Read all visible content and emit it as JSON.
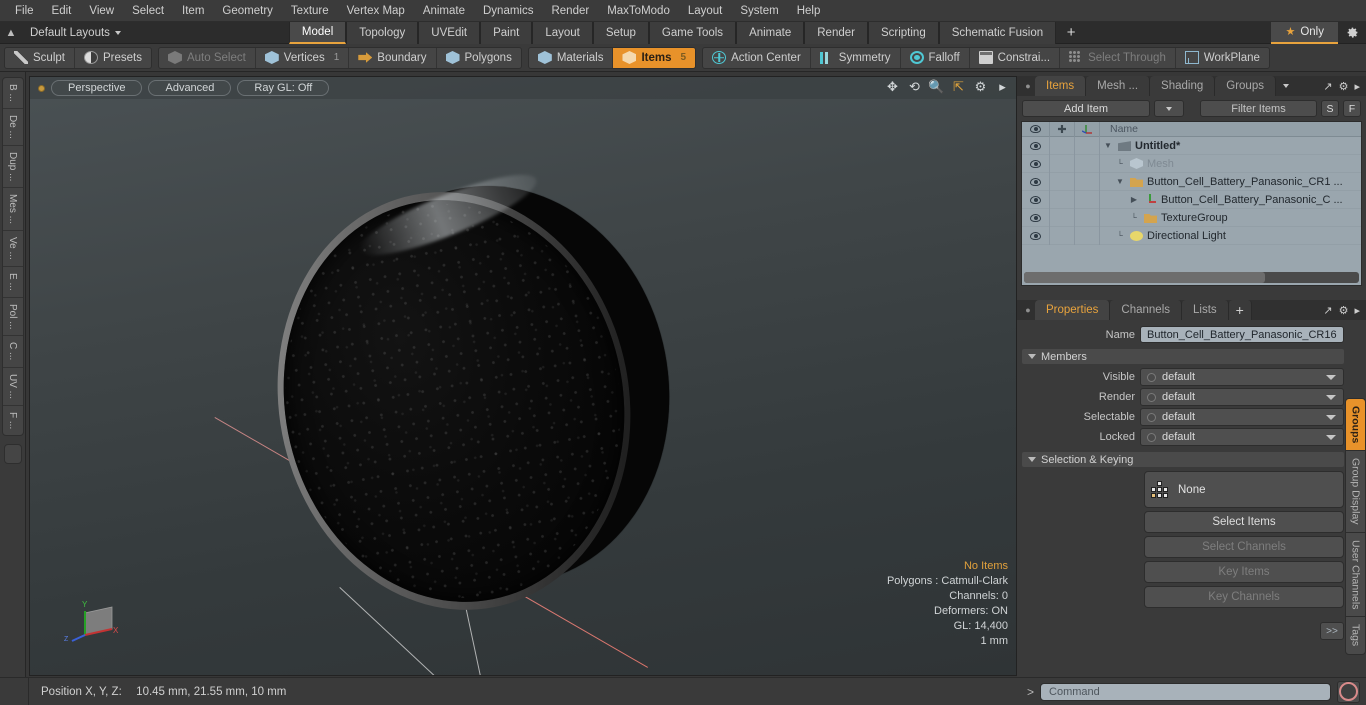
{
  "menu": {
    "items": [
      "File",
      "Edit",
      "View",
      "Select",
      "Item",
      "Geometry",
      "Texture",
      "Vertex Map",
      "Animate",
      "Dynamics",
      "Render",
      "MaxToModo",
      "Layout",
      "System",
      "Help"
    ]
  },
  "layout_bar": {
    "home_icon": "home-arrow-icon",
    "layouts_label": "Default Layouts",
    "tabs": [
      {
        "label": "Model",
        "active": true
      },
      {
        "label": "Topology",
        "active": false
      },
      {
        "label": "UVEdit",
        "active": false
      },
      {
        "label": "Paint",
        "active": false
      },
      {
        "label": "Layout",
        "active": false
      },
      {
        "label": "Setup",
        "active": false
      },
      {
        "label": "Game Tools",
        "active": false
      },
      {
        "label": "Animate",
        "active": false
      },
      {
        "label": "Render",
        "active": false
      },
      {
        "label": "Scripting",
        "active": false
      },
      {
        "label": "Schematic Fusion",
        "active": false
      }
    ],
    "add_tab_label": "+",
    "only_label": "Only",
    "gear_icon": "gear-icon",
    "accent_color": "#e8a33d"
  },
  "toolbar": {
    "group1": [
      {
        "label": "Sculpt",
        "icon": "sculpt-pencil-icon",
        "state": "normal"
      },
      {
        "label": "Presets",
        "icon": "presets-sphere-icon",
        "state": "normal"
      }
    ],
    "group2": [
      {
        "label": "Auto Select",
        "icon": "cube-grey-icon",
        "state": "disabled",
        "count": ""
      },
      {
        "label": "Vertices",
        "icon": "cube-blue-icon",
        "state": "normal",
        "count": "1"
      },
      {
        "label": "Boundary",
        "icon": "arrow-box-icon",
        "state": "normal",
        "count": ""
      },
      {
        "label": "Polygons",
        "icon": "cube-blue-icon",
        "state": "normal",
        "count": ""
      }
    ],
    "group3": [
      {
        "label": "Materials",
        "icon": "cube-blue-icon",
        "state": "normal",
        "count": ""
      },
      {
        "label": "Items",
        "icon": "cube-orange-icon",
        "state": "selected",
        "count": "5"
      }
    ],
    "group4": [
      {
        "label": "Action Center",
        "icon": "action-center-icon",
        "state": "normal"
      },
      {
        "label": "Symmetry",
        "icon": "symmetry-bars-icon",
        "state": "normal"
      },
      {
        "label": "Falloff",
        "icon": "falloff-circle-icon",
        "state": "normal"
      },
      {
        "label": "Constrai...",
        "icon": "constraint-square-icon",
        "state": "normal"
      },
      {
        "label": "Select Through",
        "icon": "select-through-dots-icon",
        "state": "disabled"
      },
      {
        "label": "WorkPlane",
        "icon": "workplane-grid-icon",
        "state": "normal"
      }
    ],
    "selected_color": "#e8922a"
  },
  "left_toolbox": {
    "tabs": [
      "B ...",
      "De ...",
      "Dup ...",
      "Mes ...",
      "Ve ...",
      "E ...",
      "Pol ...",
      "C ...",
      "UV ...",
      "F ..."
    ]
  },
  "viewport": {
    "view_mode": "Perspective",
    "shading_mode": "Advanced",
    "raygl": "Ray GL: Off",
    "header_icons": [
      "move-icon",
      "rotate-icon",
      "zoom-icon",
      "resize-icon",
      "gear-icon",
      "play-arrow-icon"
    ],
    "gizmo_axes": [
      "Y",
      "X",
      "Z"
    ],
    "stats": {
      "selection": "No Items",
      "polygons": "Polygons : Catmull-Clark",
      "channels": "Channels: 0",
      "deformers": "Deformers: ON",
      "gl": "GL: 14,400",
      "grid": "1 mm"
    },
    "highlight_color": "#e2a13c"
  },
  "items_panel": {
    "tabs": [
      {
        "label": "Items",
        "active": true
      },
      {
        "label": "Mesh ...",
        "active": false
      },
      {
        "label": "Shading",
        "active": false
      },
      {
        "label": "Groups",
        "active": false
      }
    ],
    "add_item_label": "Add Item",
    "filter_placeholder": "Filter Items",
    "btn_s": "S",
    "btn_f": "F",
    "columns": [
      "eye-column",
      "lock-column",
      "axis-column",
      "Name"
    ],
    "tree": [
      {
        "indent": 0,
        "twirl": "open",
        "icon": "scene-icon",
        "label": "Untitled*",
        "style": "bold"
      },
      {
        "indent": 1,
        "twirl": "leaf",
        "icon": "mesh-icon",
        "label": "Mesh",
        "style": "dim"
      },
      {
        "indent": 1,
        "twirl": "open",
        "icon": "folder-icon",
        "label": "Button_Cell_Battery_Panasonic_CR1 ...",
        "style": "normal"
      },
      {
        "indent": 2,
        "twirl": "closed",
        "icon": "locator-icon",
        "label": "Button_Cell_Battery_Panasonic_C ...",
        "style": "normal"
      },
      {
        "indent": 2,
        "twirl": "leaf",
        "icon": "folder-icon",
        "label": "TextureGroup",
        "style": "normal"
      },
      {
        "indent": 1,
        "twirl": "leaf",
        "icon": "light-icon",
        "label": "Directional Light",
        "style": "normal"
      }
    ]
  },
  "properties_panel": {
    "tabs": [
      {
        "label": "Properties",
        "active": true
      },
      {
        "label": "Channels",
        "active": false
      },
      {
        "label": "Lists",
        "active": false
      },
      {
        "label": "+",
        "active": false
      }
    ],
    "name_label": "Name",
    "name_value": "Button_Cell_Battery_Panasonic_CR16",
    "members_section": "Members",
    "members": [
      {
        "label": "Visible",
        "value": "default"
      },
      {
        "label": "Render",
        "value": "default"
      },
      {
        "label": "Selectable",
        "value": "default"
      },
      {
        "label": "Locked",
        "value": "default"
      }
    ],
    "selection_section": "Selection & Keying",
    "selection_set": "None",
    "buttons": [
      {
        "label": "Select Items",
        "enabled": true
      },
      {
        "label": "Select Channels",
        "enabled": false
      },
      {
        "label": "Key Items",
        "enabled": false
      },
      {
        "label": "Key Channels",
        "enabled": false
      }
    ],
    "expand_label": ">>"
  },
  "right_vertical_tabs": [
    {
      "label": "Groups",
      "active": true
    },
    {
      "label": "Group Display",
      "active": false
    },
    {
      "label": "User Channels",
      "active": false
    },
    {
      "label": "Tags",
      "active": false
    }
  ],
  "status_bar": {
    "position_label": "Position X, Y, Z:",
    "position_value": "10.45 mm, 21.55 mm, 10 mm"
  },
  "command_bar": {
    "prompt": ">",
    "placeholder": "Command",
    "record_icon": "record-circle-icon"
  }
}
